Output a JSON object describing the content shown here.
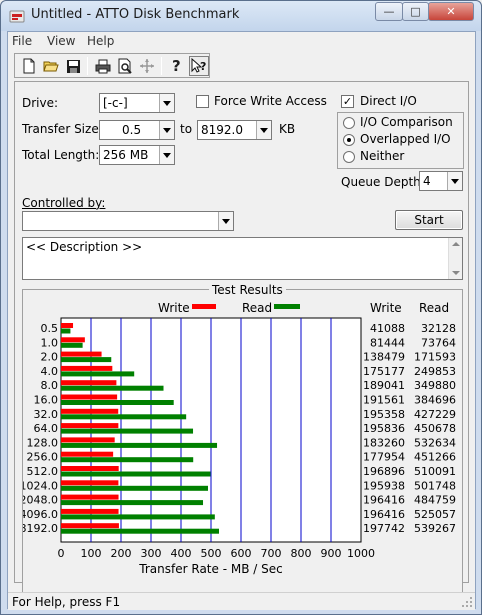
{
  "window": {
    "title": "Untitled - ATTO Disk Benchmark"
  },
  "menu": [
    "File",
    "View",
    "Help"
  ],
  "toolbar": {
    "buttons": [
      "new-icon",
      "open-icon",
      "save-icon",
      "print-icon",
      "print-preview-icon",
      "move-icon",
      "help-icon",
      "context-help-icon"
    ]
  },
  "settings": {
    "drive_label": "Drive:",
    "drive_value": "[-c-]",
    "force_write_label": "Force Write Access",
    "force_write_checked": false,
    "direct_io_label": "Direct I/O",
    "direct_io_checked": true,
    "transfer_size_label": "Transfer Size:",
    "transfer_from": "0.5",
    "transfer_to_label": "to",
    "transfer_to": "8192.0",
    "transfer_unit": "KB",
    "total_length_label": "Total Length:",
    "total_length": "256 MB",
    "io_modes": [
      {
        "label": "I/O Comparison",
        "selected": false
      },
      {
        "label": "Overlapped I/O",
        "selected": true
      },
      {
        "label": "Neither",
        "selected": false
      }
    ],
    "queue_depth_label": "Queue Depth:",
    "queue_depth": "4",
    "controlled_by_label": "Controlled by:",
    "controlled_by_value": "",
    "start_label": "Start",
    "description": "<< Description >>"
  },
  "results": {
    "title": "Test Results",
    "legend_write": "Write",
    "legend_read": "Read",
    "col_write": "Write",
    "col_read": "Read",
    "write_color": "#ff0000",
    "read_color": "#008000",
    "rows": [
      {
        "size": "0.5",
        "write": "41088",
        "read": "32128"
      },
      {
        "size": "1.0",
        "write": "81444",
        "read": "73764"
      },
      {
        "size": "2.0",
        "write": "138479",
        "read": "171593"
      },
      {
        "size": "4.0",
        "write": "175177",
        "read": "249853"
      },
      {
        "size": "8.0",
        "write": "189041",
        "read": "349880"
      },
      {
        "size": "16.0",
        "write": "191561",
        "read": "384696"
      },
      {
        "size": "32.0",
        "write": "195358",
        "read": "427229"
      },
      {
        "size": "64.0",
        "write": "195836",
        "read": "450678"
      },
      {
        "size": "128.0",
        "write": "183260",
        "read": "532634"
      },
      {
        "size": "256.0",
        "write": "177954",
        "read": "451266"
      },
      {
        "size": "512.0",
        "write": "196896",
        "read": "510091"
      },
      {
        "size": "1024.0",
        "write": "195938",
        "read": "501748"
      },
      {
        "size": "2048.0",
        "write": "196416",
        "read": "484759"
      },
      {
        "size": "4096.0",
        "write": "196416",
        "read": "525057"
      },
      {
        "size": "8192.0",
        "write": "197742",
        "read": "539267"
      }
    ],
    "axis_ticks": [
      "0",
      "100",
      "200",
      "300",
      "400",
      "500",
      "600",
      "700",
      "800",
      "900",
      "1000"
    ],
    "axis_label": "Transfer Rate - MB / Sec",
    "axis_max": 1000
  },
  "status": {
    "text": "For Help, press F1"
  }
}
